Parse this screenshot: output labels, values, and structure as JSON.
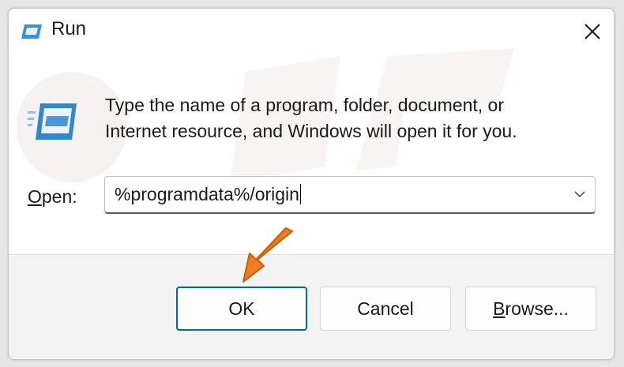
{
  "window": {
    "title": "Run",
    "close_icon": "close-icon",
    "app_icon": "run-app-icon"
  },
  "main": {
    "description_line1": "Type the name of a program, folder, document, or",
    "description_line2": "Internet resource, and Windows will open it for you.",
    "icon": "run-app-icon"
  },
  "open_field": {
    "label_mnemonic": "O",
    "label_rest": "pen:",
    "value": "%programdata%/origin",
    "dropdown_icon": "chevron-down-icon"
  },
  "buttons": {
    "ok": "OK",
    "cancel": "Cancel",
    "browse_mnemonic": "B",
    "browse_rest": "rowse..."
  },
  "annotation": {
    "pointer": "orange-arrow-icon",
    "color": "#f07d1e"
  },
  "colors": {
    "accent": "#0067c0",
    "footer_bg": "#f3f3f3",
    "arrow": "#f07d1e"
  }
}
